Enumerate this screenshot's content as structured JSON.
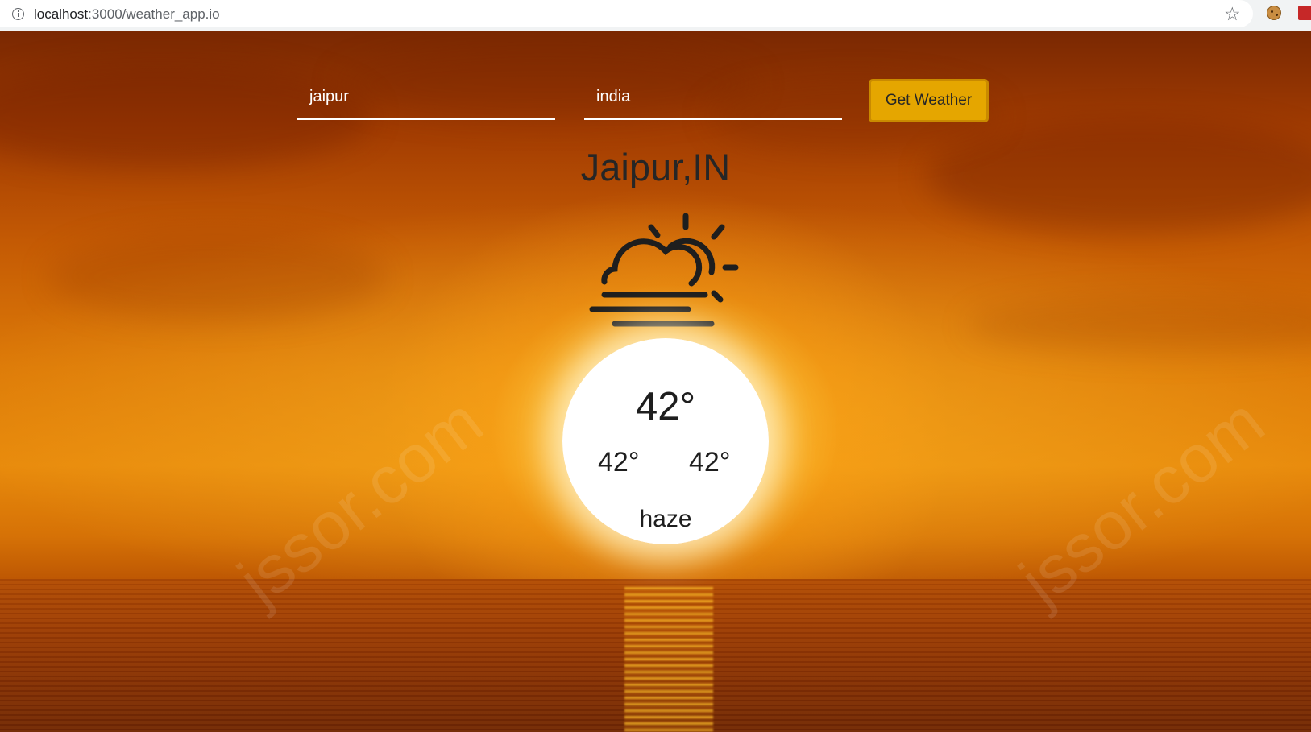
{
  "browser": {
    "url_host": "localhost",
    "url_path": ":3000/weather_app.io"
  },
  "form": {
    "city_value": "jaipur",
    "country_value": "india",
    "submit_label": "Get Weather"
  },
  "weather": {
    "location": "Jaipur,IN",
    "icon": "sun-haze-icon",
    "temperature": "42°",
    "temp_min": "42°",
    "temp_max": "42°",
    "description": "haze"
  },
  "watermark": "jssor.com",
  "colors": {
    "button": "#e5a600",
    "text": "#262626",
    "input_text": "#ffffff"
  }
}
